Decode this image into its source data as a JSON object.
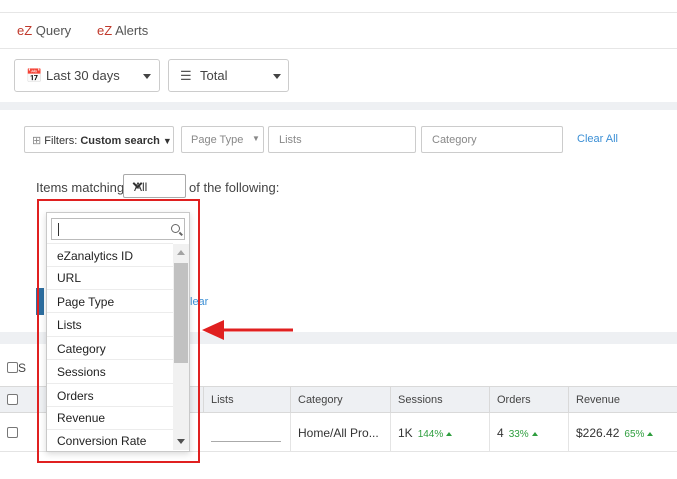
{
  "tabs": [
    {
      "prefix": "eZ",
      "label": " Query"
    },
    {
      "prefix": "eZ",
      "label": " Alerts"
    }
  ],
  "controls": {
    "date_icon": "calendar-icon",
    "date_label": "Last 30 days",
    "total_icon": "list-icon",
    "total_label": "Total"
  },
  "filters": {
    "button_prefix": "Filters: ",
    "button_label": "Custom search",
    "page_type": "Page Type",
    "lists_placeholder": "Lists",
    "category_placeholder": "Category",
    "clear_all": "Clear All",
    "items_matching": "Items matching",
    "match_value": "All",
    "of_following": "of the following:",
    "clear_link": "lear"
  },
  "dropdown": {
    "search_icon": "search-icon",
    "options": [
      "eZanalytics ID",
      "URL",
      "Page Type",
      "Lists",
      "Category",
      "Sessions",
      "Orders",
      "Revenue",
      "Conversion Rate"
    ]
  },
  "table": {
    "select_label": "S",
    "columns": [
      "Lists",
      "Category",
      "Sessions",
      "Orders",
      "Revenue"
    ],
    "row": {
      "category": "Home/All Pro...",
      "sessions": "1K",
      "sessions_pct": "144%",
      "orders": "4",
      "orders_pct": "33%",
      "revenue": "$226.42",
      "revenue_pct": "65%"
    }
  },
  "annotation": {
    "color": "#e02020"
  }
}
